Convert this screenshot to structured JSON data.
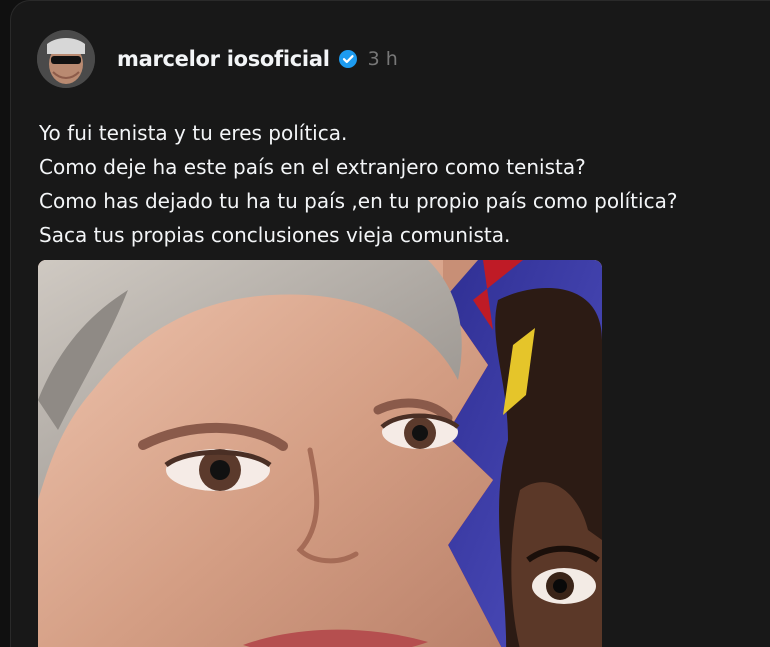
{
  "post": {
    "username": "marcelor iosoficial",
    "time": "3 h",
    "verified": true,
    "avatar_icon": "avatar-sunglasses-man",
    "text_lines": [
      "Yo fui tenista y tu eres política.",
      "Como deje ha este país en el extranjero como tenista?",
      "Como has dejado tu ha tu país ,en tu propio país como política?",
      "Saca tus propias conclusiones vieja comunista."
    ],
    "media_description_icon": "photo-collage-icon"
  },
  "colors": {
    "background": "#181818",
    "text": "#f3f5f7",
    "muted": "#777777",
    "verified_blue": "#1d9bf0"
  }
}
